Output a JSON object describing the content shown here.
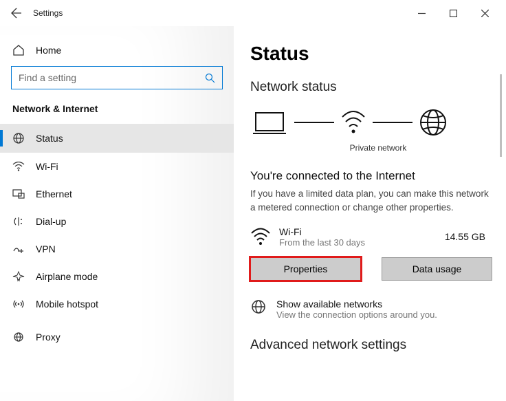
{
  "titlebar": {
    "title": "Settings"
  },
  "sidebar": {
    "home": "Home",
    "search_placeholder": "Find a setting",
    "category": "Network & Internet",
    "items": [
      {
        "label": "Status"
      },
      {
        "label": "Wi-Fi"
      },
      {
        "label": "Ethernet"
      },
      {
        "label": "Dial-up"
      },
      {
        "label": "VPN"
      },
      {
        "label": "Airplane mode"
      },
      {
        "label": "Mobile hotspot"
      },
      {
        "label": "Proxy"
      }
    ]
  },
  "main": {
    "page_title": "Status",
    "section_title": "Network status",
    "diagram_caption": "Private network",
    "connected_heading": "You're connected to the Internet",
    "connected_text": "If you have a limited data plan, you can make this network a metered connection or change other properties.",
    "connection": {
      "name": "Wi-Fi",
      "sub": "From the last 30 days",
      "usage": "14.55 GB"
    },
    "buttons": {
      "properties": "Properties",
      "data_usage": "Data usage"
    },
    "show_networks": {
      "title": "Show available networks",
      "sub": "View the connection options around you."
    },
    "advanced_heading": "Advanced network settings"
  }
}
